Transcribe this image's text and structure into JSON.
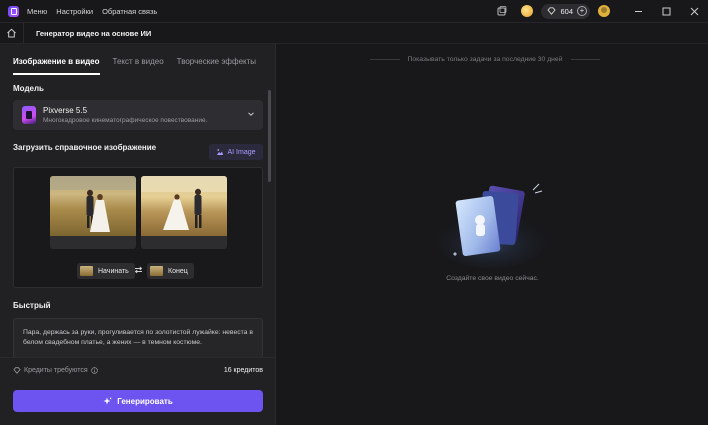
{
  "titlebar": {
    "menu": [
      "Меню",
      "Настройки",
      "Обратная связь"
    ],
    "credits": "604"
  },
  "breadcrumb": {
    "title": "Генератор видео на основе ИИ"
  },
  "tabs": [
    "Изображение в видео",
    "Текст в видео",
    "Творческие эффекты"
  ],
  "model": {
    "section_label": "Модель",
    "name": "Pixverse 5.5",
    "description": "Многокадровое кинематографическое повествование."
  },
  "upload": {
    "section_label": "Загрузить справочное изображение",
    "ai_button": "AI Image",
    "start_label": "Начинать",
    "end_label": "Конец"
  },
  "prompt": {
    "section_label": "Быстрый",
    "text": "Пара, держась за руки, прогуливается по золотистой лужайке: невеста в белом свадебном платье, а жених — в темном костюме."
  },
  "footer": {
    "credits_label": "Кредиты требуются",
    "credits_value": "16 кредитов",
    "generate_label": "Генерировать"
  },
  "right": {
    "notice": "Показывать только задачи за последние 30 дней",
    "empty_text": "Создайте свое видео сейчас."
  },
  "colors": {
    "accent": "#6d54f0",
    "ai_text": "#a99cff"
  },
  "icons": [
    "app-logo-icon",
    "tasks-icon",
    "coin-icon",
    "diamond-icon",
    "plus-icon",
    "profile-icon",
    "minimize-icon",
    "maximize-icon",
    "close-icon",
    "home-icon",
    "chevron-down-icon",
    "sparkle-icon",
    "swap-icon",
    "info-icon"
  ]
}
